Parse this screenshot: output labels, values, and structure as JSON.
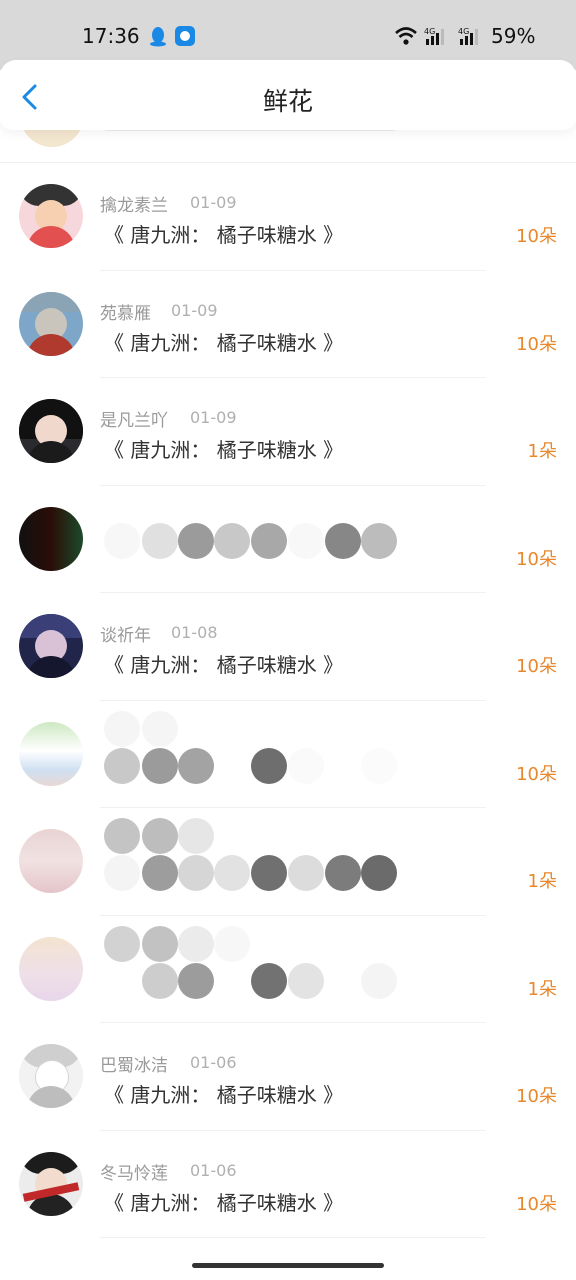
{
  "status_bar": {
    "time": "17:36",
    "battery": "59%",
    "network_1": "4G",
    "network_2": "4G"
  },
  "nav": {
    "title": "鲜花"
  },
  "items": [
    {
      "name": "擒龙素兰",
      "date": "01-09",
      "book": "《 唐九洲：  橘子味糖水 》",
      "flowers": "10朵",
      "blurred": false
    },
    {
      "name": "苑慕雁",
      "date": "01-09",
      "book": "《 唐九洲：  橘子味糖水 》",
      "flowers": "10朵",
      "blurred": false
    },
    {
      "name": "是凡兰吖",
      "date": "01-09",
      "book": "《 唐九洲：  橘子味糖水 》",
      "flowers": "1朵",
      "blurred": false
    },
    {
      "name": "",
      "date": "",
      "book": "",
      "flowers": "10朵",
      "blurred": true
    },
    {
      "name": "谈祈年",
      "date": "01-08",
      "book": "《 唐九洲：  橘子味糖水 》",
      "flowers": "10朵",
      "blurred": false
    },
    {
      "name": "",
      "date": "",
      "book": "",
      "flowers": "10朵",
      "blurred": true
    },
    {
      "name": "",
      "date": "",
      "book": "",
      "flowers": "1朵",
      "blurred": true
    },
    {
      "name": "",
      "date": "",
      "book": "",
      "flowers": "1朵",
      "blurred": true
    },
    {
      "name": "巴蜀冰洁",
      "date": "01-06",
      "book": "《 唐九洲：  橘子味糖水 》",
      "flowers": "10朵",
      "blurred": false
    },
    {
      "name": "冬马怜莲",
      "date": "01-06",
      "book": "《 唐九洲：  橘子味糖水 》",
      "flowers": "10朵",
      "blurred": false
    }
  ],
  "colors": {
    "flowers": "#e8882d",
    "back_arrow": "#1a89e6"
  }
}
